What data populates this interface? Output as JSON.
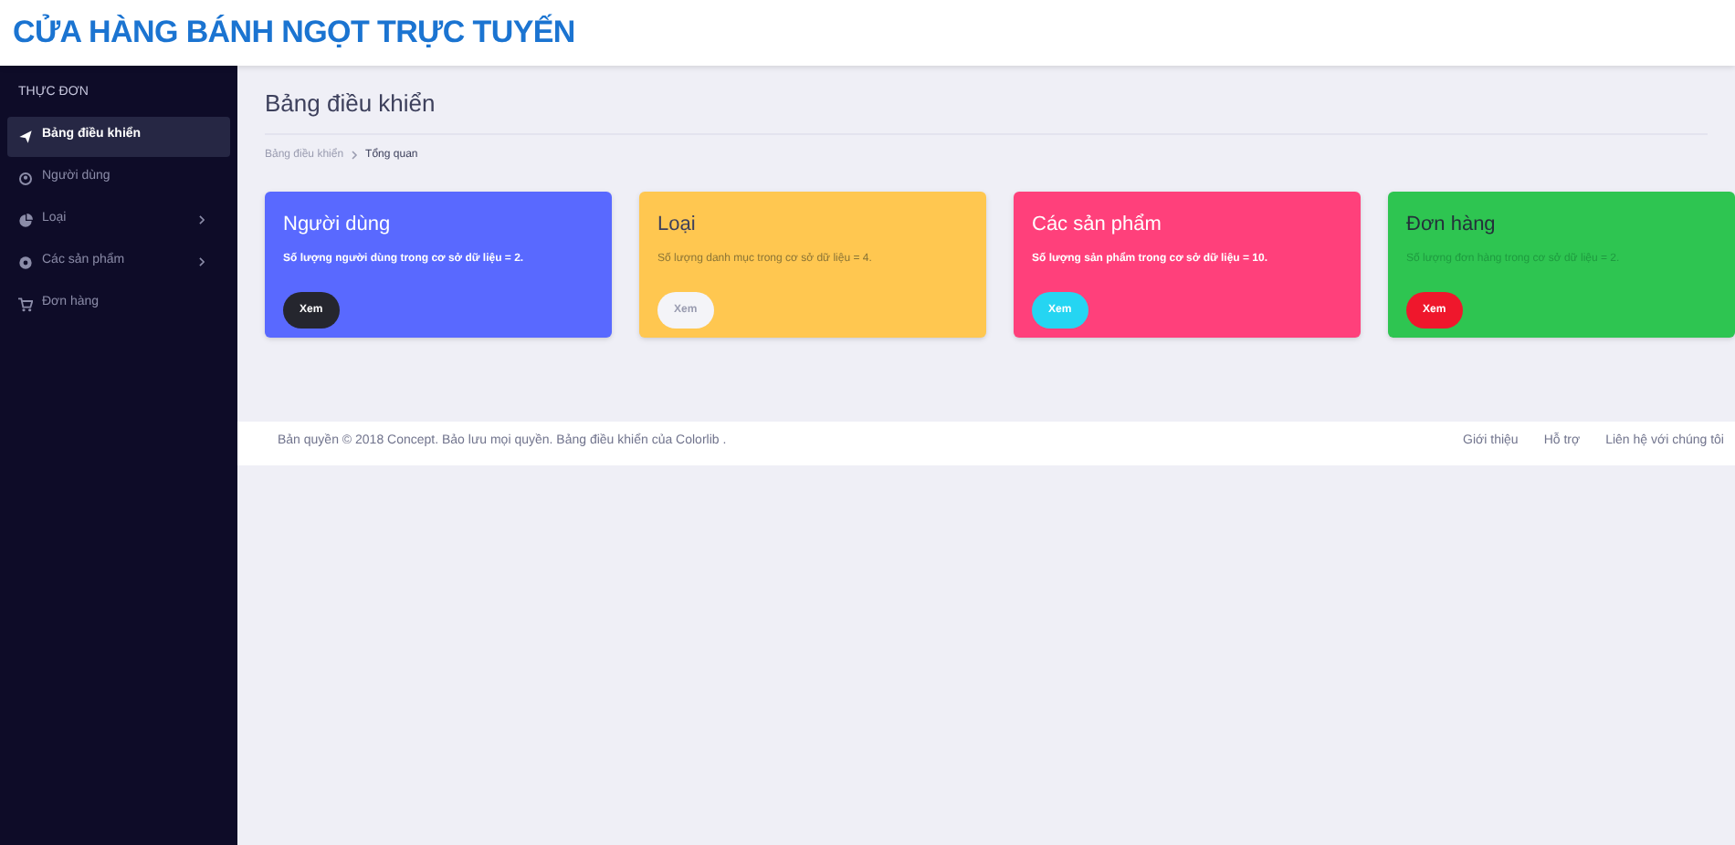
{
  "header": {
    "title": "CỬA HÀNG BÁNH NGỌT TRỰC TUYẾN"
  },
  "sidebar": {
    "heading": "THỰC ĐƠN",
    "items": [
      {
        "label": "Bảng điều khiển",
        "selected": true,
        "expandable": false
      },
      {
        "label": "Người dùng",
        "selected": false,
        "expandable": false
      },
      {
        "label": "Loại",
        "selected": false,
        "expandable": true
      },
      {
        "label": "Các sản phẩm",
        "selected": false,
        "expandable": true
      },
      {
        "label": "Đơn hàng",
        "selected": false,
        "expandable": false
      }
    ]
  },
  "page": {
    "title": "Bảng điều khiển",
    "breadcrumb": [
      "Bảng điều khiển",
      "Tổng quan"
    ]
  },
  "cards": [
    {
      "kind": "primary",
      "color": "#5969ff",
      "title": "Người dùng",
      "text": "Số lượng người dùng trong cơ sở dữ liệu = 2.",
      "button": "Xem"
    },
    {
      "kind": "warning",
      "color": "#ffc750",
      "title": "Loại",
      "text": "Số lượng danh mục trong cơ sở dữ liệu = 4.",
      "button": "Xem"
    },
    {
      "kind": "secondary",
      "color": "#ff407b",
      "title": "Các sản phẩm",
      "text": "Số lượng sản phẩm trong cơ sở dữ liệu = 10.",
      "button": "Xem"
    },
    {
      "kind": "success",
      "color": "#2ec551",
      "title": "Đơn hàng",
      "text": "Số lượng đơn hàng trong cơ sở dữ liệu = 2.",
      "button": "Xem"
    }
  ],
  "footer": {
    "text": "Bản quyền © 2018 Concept. Bảo lưu mọi quyền. Bảng điều khiển của Colorlib .",
    "links": [
      "Giới thiệu",
      "Hỗ trợ",
      "Liên hệ với chúng tôi"
    ]
  }
}
